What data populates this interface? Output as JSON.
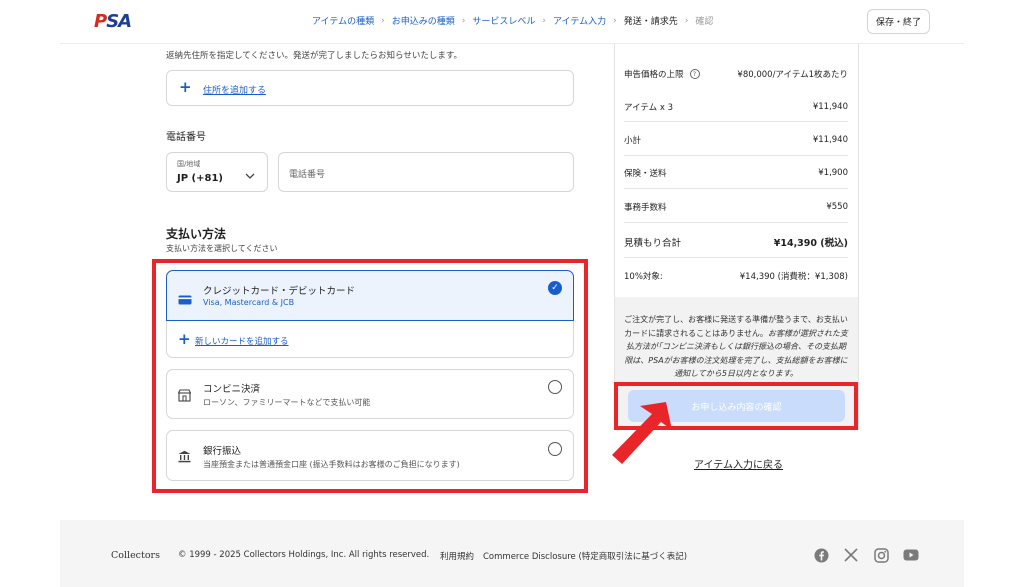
{
  "header": {
    "logo": "PSA",
    "steps": [
      {
        "label": "アイテムの種類",
        "state": "done"
      },
      {
        "label": "お申込みの種類",
        "state": "done"
      },
      {
        "label": "サービスレベル",
        "state": "done"
      },
      {
        "label": "アイテム入力",
        "state": "done"
      },
      {
        "label": "発送・請求先",
        "state": "current"
      },
      {
        "label": "確認",
        "state": "future"
      }
    ],
    "save_label": "保存・終了"
  },
  "shipping": {
    "return_notice": "返納先住所を指定してください。発送が完了しましたらお知らせいたします。",
    "add_address": "住所を追加する"
  },
  "phone": {
    "title": "電話番号",
    "country_label": "国/地域",
    "country_value": "JP (+81)",
    "phone_placeholder": "電話番号"
  },
  "payment": {
    "title": "支払い方法",
    "subtitle": "支払い方法を選択してください",
    "methods": [
      {
        "title": "クレジットカード・デビットカード",
        "sub": "Visa, Mastercard & JCB",
        "selected": true
      },
      {
        "title": "コンビニ決済",
        "sub": "ローソン、ファミリーマートなどで支払い可能",
        "selected": false
      },
      {
        "title": "銀行振込",
        "sub": "当座預金または普通預金口座 (振込手数料はお客様のご負担になります)",
        "selected": false
      }
    ],
    "add_card": "新しいカードを追加する"
  },
  "summary": {
    "rows": [
      {
        "label": "申告価格の上限",
        "value": "¥80,000/アイテム1枚あたり"
      },
      {
        "label": "アイテム x 3",
        "value": "¥11,940"
      },
      {
        "label": "小計",
        "value": "¥11,940"
      },
      {
        "label": "保険・送料",
        "value": "¥1,900"
      },
      {
        "label": "事務手数料",
        "value": "¥550"
      },
      {
        "label": "見積もり合計",
        "value": "¥14,390 (税込)"
      },
      {
        "label": "10%対象:",
        "value": "¥14,390 (消費税：¥1,308)"
      }
    ],
    "notice_normal_1": "ご注文が完了し、お客様に発送する準備が整うまで、お支払いカードに請求されることはありません。",
    "notice_italic": "お客様が選択された支払方法が｢コンビニ決済もしくは銀行振込の場合、その支払期限は、PSAがお客様の注文処理を完了し、支払総額をお客様に通知してから5日以内となります。",
    "confirm_label": "お申し込み内容の確認",
    "back_label": "アイテム入力に戻る"
  },
  "footer": {
    "brand": "Collectors",
    "copyright": "© 1999 - 2025 Collectors Holdings, Inc. All rights reserved.",
    "terms": "利用規約",
    "commerce": "Commerce Disclosure (特定商取引法に基づく表記)"
  },
  "colors": {
    "accent": "#1a5fc9",
    "highlight": "#e8262a",
    "button_disabled": "#c9dcfb"
  }
}
